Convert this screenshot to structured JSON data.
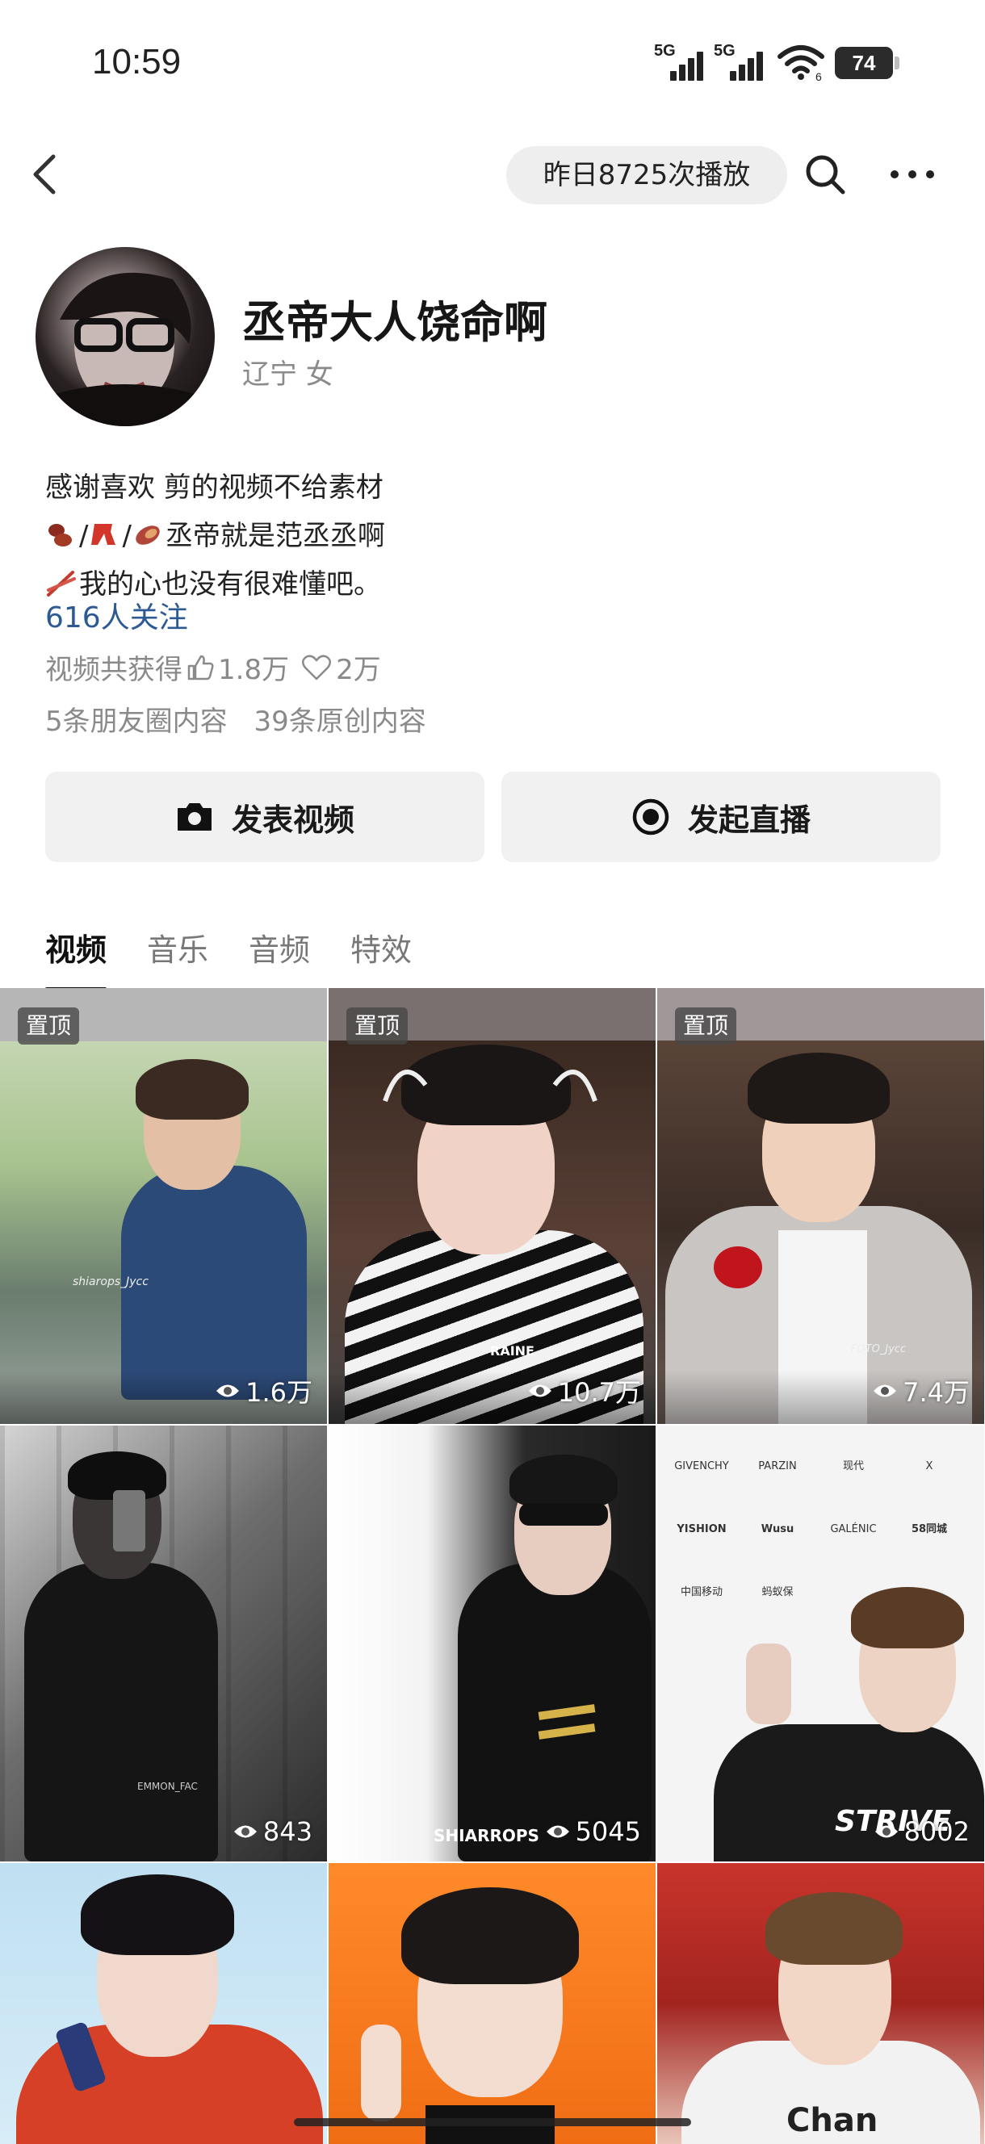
{
  "status_bar": {
    "time": "10:59",
    "network_1": "5G",
    "network_2": "5G",
    "wifi_sub": "6",
    "battery": "74"
  },
  "header": {
    "plays_yesterday": "昨日8725次播放"
  },
  "profile": {
    "username": "丞帝大人饶命啊",
    "region_gender": "辽宁 女",
    "bio_line_1": "感谢喜欢 剪的视频不给素材",
    "bio_line_2_sep_1": "/",
    "bio_line_2_sep_2": "/",
    "bio_line_2_text": "丞帝就是范丞丞啊",
    "bio_line_3_text": "我的心也没有很难懂吧。",
    "followers": "616人关注",
    "likes_prefix": "视频共获得",
    "likes_count": "1.8万",
    "hearts_count": "2万",
    "moments_count": "5条朋友圈内容",
    "original_count": "39条原创内容"
  },
  "actions": {
    "post_video": "发表视频",
    "go_live": "发起直播"
  },
  "tabs": [
    {
      "label": "视频",
      "active": true
    },
    {
      "label": "音乐",
      "active": false
    },
    {
      "label": "音频",
      "active": false
    },
    {
      "label": "特效",
      "active": false
    }
  ],
  "videos": [
    {
      "pinned_label": "置顶",
      "views": "1.6万",
      "watermark": "shiarops_Jycc"
    },
    {
      "pinned_label": "置顶",
      "views": "10.7万",
      "watermark": "RAINE"
    },
    {
      "pinned_label": "置顶",
      "views": "7.4万",
      "watermark": "FOTO_Jycc"
    },
    {
      "views": "843",
      "watermark": "EMMON_FAC"
    },
    {
      "views": "5045",
      "watermark": "SHIARROPS"
    },
    {
      "views": "8002",
      "brands": [
        "GIVENCHY",
        "PARZIN",
        "现代",
        "X",
        "YISHION",
        "Wusu",
        "GALÉNIC",
        "58同城",
        "中国移动",
        "蚂蚁保"
      ],
      "shirt_text": "STRIVE"
    },
    {},
    {},
    {
      "shirt_text": "Chan"
    }
  ],
  "colors": {
    "link": "#2d5a93",
    "muted": "#8a8a8a",
    "button_bg": "#f1f1f1",
    "pill_bg": "#eeeeee"
  }
}
